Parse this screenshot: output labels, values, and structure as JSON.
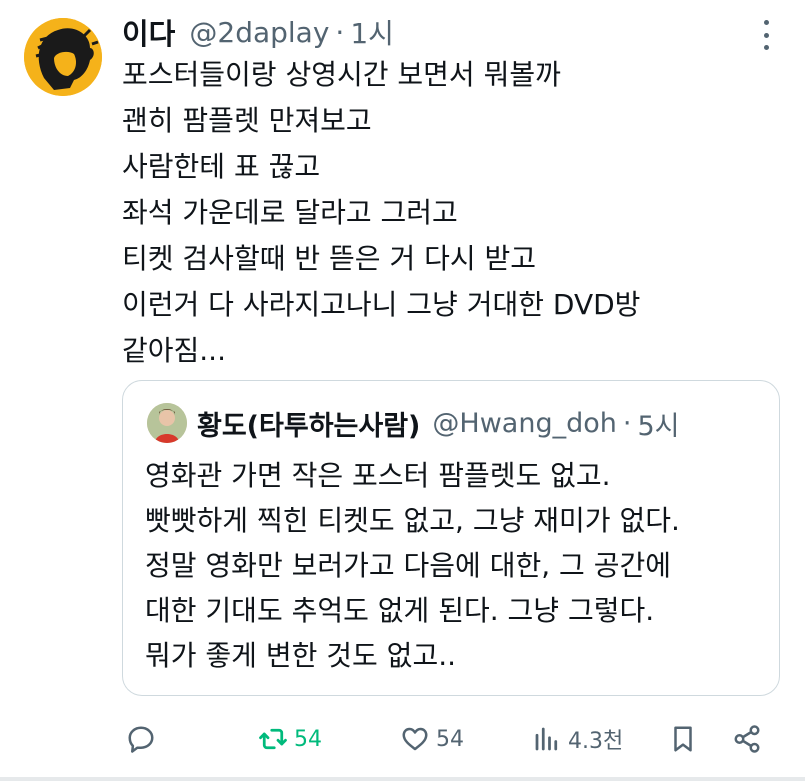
{
  "tweet": {
    "author_name": "이다",
    "handle": "@2daplay",
    "separator": "·",
    "time": "1시",
    "lines": [
      "포스터들이랑 상영시간 보면서 뭐볼까",
      "괜히 팜플렛 만져보고",
      "사람한테 표 끊고",
      "좌석 가운데로 달라고 그러고",
      "티켓 검사할때 반 뜯은 거 다시 받고",
      "이런거 다 사라지고나니 그냥 거대한 DVD방",
      "같아짐..."
    ]
  },
  "quote": {
    "author_name": "황도(타투하는사람)",
    "handle": "@Hwang_doh",
    "separator": "·",
    "time": "5시",
    "lines": [
      "영화관 가면 작은 포스터 팜플렛도 없고.",
      "빳빳하게 찍힌 티켓도 없고, 그냥 재미가 없다.",
      "정말 영화만 보러가고 다음에 대한, 그 공간에",
      "대한 기대도 추억도 없게 된다. 그냥 그렇다.",
      "뭐가 좋게 변한 것도 없고.."
    ]
  },
  "actions": {
    "reply_icon": "reply-icon",
    "retweet_count": "54",
    "like_count": "54",
    "views_count": "4.3천"
  },
  "colors": {
    "retweet_active": "#00ba7c",
    "secondary_text": "#536471",
    "avatar_bg": "#f5b21a"
  }
}
